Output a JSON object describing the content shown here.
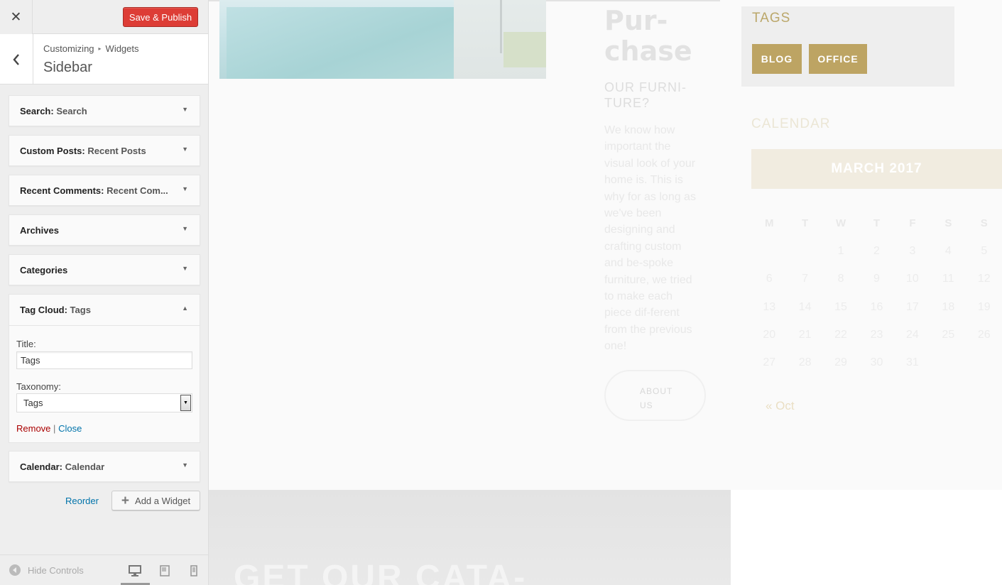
{
  "header": {
    "close_icon": "close-icon",
    "save_label": "Save & Publish"
  },
  "section": {
    "breadcrumb_root": "Customizing",
    "breadcrumb_current": "Widgets",
    "title": "Sidebar"
  },
  "widgets": [
    {
      "type": "Search",
      "title": "Search"
    },
    {
      "type": "Custom Posts",
      "title": "Recent Posts"
    },
    {
      "type": "Recent Comments",
      "title": "Recent Com..."
    },
    {
      "type": "Archives",
      "title": ""
    },
    {
      "type": "Categories",
      "title": ""
    },
    {
      "type": "Tag Cloud",
      "title": "Tags"
    },
    {
      "type": "Calendar",
      "title": "Calendar"
    }
  ],
  "tag_cloud_form": {
    "title_label": "Title:",
    "title_value": "Tags",
    "taxonomy_label": "Taxonomy:",
    "taxonomy_value": "Tags",
    "remove_label": "Remove",
    "separator": "|",
    "close_label": "Close"
  },
  "actions": {
    "reorder_label": "Reorder",
    "add_widget_label": "Add a Widget"
  },
  "footer": {
    "hide_controls_label": "Hide Controls",
    "devices": [
      "desktop",
      "tablet",
      "mobile"
    ],
    "active_device": "desktop"
  },
  "preview": {
    "promo_heading_line1": "Pur-",
    "promo_heading_line2": "chase",
    "promo_sub_line1": "OUR FURNI-",
    "promo_sub_line2": "TURE?",
    "promo_text": "We know how important the visual look of your home is. This is why for as long as we've been designing and crafting custom and be-spoke furniture, we tried to make each piece dif-ferent from the previous one!",
    "about_line1": "ABOUT",
    "about_line2": "US",
    "tags_title": "TAGS",
    "tags": [
      "BLOG",
      "OFFICE"
    ],
    "calendar_title": "CALENDAR",
    "calendar_month": "MARCH 2017",
    "calendar_days": [
      "M",
      "T",
      "W",
      "T",
      "F",
      "S",
      "S"
    ],
    "calendar_weeks": [
      [
        "",
        "",
        "1",
        "2",
        "3",
        "4",
        "5"
      ],
      [
        "6",
        "7",
        "8",
        "9",
        "10",
        "11",
        "12"
      ],
      [
        "13",
        "14",
        "15",
        "16",
        "17",
        "18",
        "19"
      ],
      [
        "20",
        "21",
        "22",
        "23",
        "24",
        "25",
        "26"
      ],
      [
        "27",
        "28",
        "29",
        "30",
        "31",
        "",
        ""
      ]
    ],
    "calendar_prev": "« Oct",
    "catalog_title": "GET OUR CATA-"
  },
  "colors": {
    "publish_button": "#dd3d36",
    "link": "#0073aa",
    "remove_link": "#aa0000",
    "tag_button": "#bda463",
    "tags_heading": "#bba76a"
  }
}
